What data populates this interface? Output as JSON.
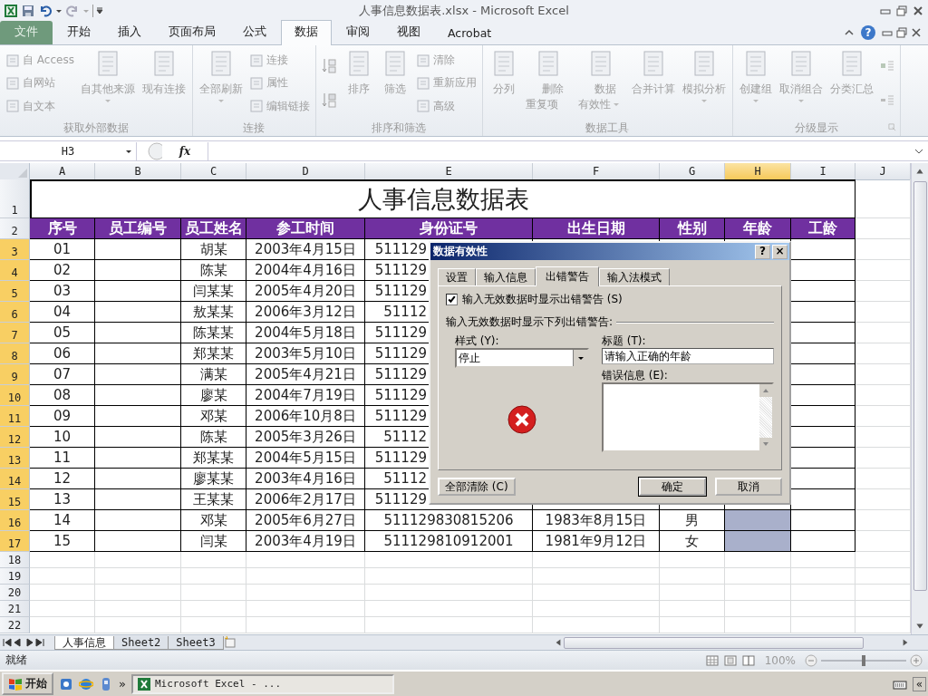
{
  "window": {
    "title": "人事信息数据表.xlsx - Microsoft Excel",
    "help_label": "?"
  },
  "ribbon_tabs": [
    {
      "label": "文件",
      "kind": "file",
      "selected": false
    },
    {
      "label": "开始",
      "kind": "tab",
      "selected": false
    },
    {
      "label": "插入",
      "kind": "tab",
      "selected": false
    },
    {
      "label": "页面布局",
      "kind": "tab",
      "selected": false
    },
    {
      "label": "公式",
      "kind": "tab",
      "selected": false
    },
    {
      "label": "数据",
      "kind": "tab",
      "selected": true
    },
    {
      "label": "审阅",
      "kind": "tab",
      "selected": false
    },
    {
      "label": "视图",
      "kind": "tab",
      "selected": false
    },
    {
      "label": "Acrobat",
      "kind": "tab",
      "selected": false
    }
  ],
  "ribbon_groups": [
    {
      "title": "获取外部数据",
      "launcher": false,
      "items": [
        {
          "kind": "stack",
          "children": [
            {
              "label": "自 Access"
            },
            {
              "label": "自网站"
            },
            {
              "label": "自文本"
            }
          ]
        },
        {
          "kind": "large",
          "label": "自其他来源",
          "dropdown": true
        },
        {
          "kind": "large",
          "label": "现有连接",
          "dropdown": false
        }
      ]
    },
    {
      "title": "连接",
      "launcher": false,
      "items": [
        {
          "kind": "large",
          "label": "全部刷新",
          "dropdown": true
        },
        {
          "kind": "stack",
          "children": [
            {
              "label": "连接"
            },
            {
              "label": "属性"
            },
            {
              "label": "编辑链接"
            }
          ]
        }
      ]
    },
    {
      "title": "排序和筛选",
      "launcher": false,
      "items": [
        {
          "kind": "sort"
        },
        {
          "kind": "large",
          "label": "排序",
          "dropdown": false
        },
        {
          "kind": "large",
          "label": "筛选",
          "dropdown": false
        },
        {
          "kind": "stack",
          "children": [
            {
              "label": "清除"
            },
            {
              "label": "重新应用"
            },
            {
              "label": "高级"
            }
          ]
        }
      ]
    },
    {
      "title": "数据工具",
      "launcher": false,
      "items": [
        {
          "kind": "large",
          "label": "分列",
          "dropdown": false
        },
        {
          "kind": "tall",
          "label": "删除重复项",
          "dropdown": false
        },
        {
          "kind": "tall",
          "label": "数据有效性",
          "dropdown": true
        },
        {
          "kind": "large",
          "label": "合并计算",
          "dropdown": false
        },
        {
          "kind": "large",
          "label": "模拟分析",
          "dropdown": true
        }
      ]
    },
    {
      "title": "分级显示",
      "launcher": true,
      "items": [
        {
          "kind": "large",
          "label": "创建组",
          "dropdown": true
        },
        {
          "kind": "large",
          "label": "取消组合",
          "dropdown": true
        },
        {
          "kind": "large",
          "label": "分类汇总",
          "dropdown": false
        },
        {
          "kind": "icons"
        }
      ]
    }
  ],
  "formula_bar": {
    "name_box": "H3",
    "function_label": "fx"
  },
  "sheet": {
    "columns": [
      {
        "label": "A",
        "selected": false
      },
      {
        "label": "B",
        "selected": false
      },
      {
        "label": "C",
        "selected": false
      },
      {
        "label": "D",
        "selected": false
      },
      {
        "label": "E",
        "selected": false
      },
      {
        "label": "F",
        "selected": false
      },
      {
        "label": "G",
        "selected": false
      },
      {
        "label": "H",
        "selected": true
      },
      {
        "label": "I",
        "selected": false
      },
      {
        "label": "J",
        "selected": false
      }
    ],
    "rows": [
      {
        "kind": "title",
        "number": "1",
        "selected": false,
        "title": "人事信息数据表"
      },
      {
        "kind": "header",
        "number": "2",
        "selected": false,
        "headers": [
          "序号",
          "员工编号",
          "员工姓名",
          "参工时间",
          "身份证号",
          "出生日期",
          "性别",
          "年龄",
          "工龄"
        ]
      },
      {
        "kind": "data",
        "number": "3",
        "selected": true,
        "cells": [
          "01",
          null,
          "胡某",
          "2003年4月15日",
          "511129"
        ]
      },
      {
        "kind": "data",
        "number": "4",
        "selected": true,
        "cells": [
          "02",
          null,
          "陈某",
          "2004年4月16日",
          "511129"
        ]
      },
      {
        "kind": "data",
        "number": "5",
        "selected": true,
        "cells": [
          "03",
          null,
          "闫某某",
          "2005年4月20日",
          "511129"
        ]
      },
      {
        "kind": "data",
        "number": "6",
        "selected": true,
        "cells": [
          "04",
          null,
          "敖某某",
          "2006年3月12日",
          "51112"
        ]
      },
      {
        "kind": "data",
        "number": "7",
        "selected": true,
        "cells": [
          "05",
          null,
          "陈某某",
          "2004年5月18日",
          "511129"
        ]
      },
      {
        "kind": "data",
        "number": "8",
        "selected": true,
        "cells": [
          "06",
          null,
          "郑某某",
          "2003年5月10日",
          "511129"
        ]
      },
      {
        "kind": "data",
        "number": "9",
        "selected": true,
        "cells": [
          "07",
          null,
          "满某",
          "2005年4月21日",
          "511129"
        ]
      },
      {
        "kind": "data",
        "number": "10",
        "selected": true,
        "cells": [
          "08",
          null,
          "廖某",
          "2004年7月19日",
          "511129"
        ]
      },
      {
        "kind": "data",
        "number": "11",
        "selected": true,
        "cells": [
          "09",
          null,
          "邓某",
          "2006年10月8日",
          "511129"
        ]
      },
      {
        "kind": "data",
        "number": "12",
        "selected": true,
        "cells": [
          "10",
          null,
          "陈某",
          "2005年3月26日",
          "51112"
        ]
      },
      {
        "kind": "data",
        "number": "13",
        "selected": true,
        "cells": [
          "11",
          null,
          "郑某某",
          "2004年5月15日",
          "511129"
        ]
      },
      {
        "kind": "data",
        "number": "14",
        "selected": true,
        "cells": [
          "12",
          null,
          "廖某某",
          "2003年4月16日",
          "51112"
        ]
      },
      {
        "kind": "data",
        "number": "15",
        "selected": true,
        "cells": [
          "13",
          null,
          "王某某",
          "2006年2月17日",
          "511129"
        ]
      },
      {
        "kind": "data",
        "number": "16",
        "selected": true,
        "cells": [
          "14",
          null,
          "邓某",
          "2005年6月27日",
          "511129830815206",
          "1983年8月15日",
          "男"
        ]
      },
      {
        "kind": "data",
        "number": "17",
        "selected": true,
        "cells": [
          "15",
          null,
          "闫某",
          "2003年4月19日",
          "511129810912001",
          "1981年9月12日",
          "女"
        ]
      },
      {
        "kind": "blank",
        "number": "18",
        "selected": false
      },
      {
        "kind": "blank",
        "number": "19",
        "selected": false
      },
      {
        "kind": "blank",
        "number": "20",
        "selected": false
      },
      {
        "kind": "blank",
        "number": "21",
        "selected": false
      },
      {
        "kind": "blank",
        "number": "22",
        "selected": false
      }
    ]
  },
  "sheet_tabs": [
    {
      "label": "人事信息",
      "selected": true
    },
    {
      "label": "Sheet2",
      "selected": false
    },
    {
      "label": "Sheet3",
      "selected": false
    }
  ],
  "status_bar": {
    "text": "就绪",
    "zoom": "100%",
    "zoom_slider": {
      "level": 0.5
    }
  },
  "taskbar": {
    "start": "开始",
    "more": "»",
    "tasks": [
      {
        "label": "Microsoft Excel - ...",
        "selected": true
      }
    ],
    "tray_more": "«"
  },
  "dialog": {
    "title": "数据有效性",
    "help": "?",
    "close": "×",
    "tabs": [
      {
        "label": "设置",
        "selected": false
      },
      {
        "label": "输入信息",
        "selected": false
      },
      {
        "label": "出错警告",
        "selected": true
      },
      {
        "label": "输入法模式",
        "selected": false
      }
    ],
    "show_alert": {
      "label": "输入无效数据时显示出错警告 (S)",
      "checked": true
    },
    "section": "输入无效数据时显示下列出错警告:",
    "style_label": "样式 (Y):",
    "style_value": "停止",
    "title_label": "标题 (T):",
    "title_value": "请输入正确的年龄",
    "message_label": "错误信息 (E):",
    "buttons": [
      {
        "label": "全部清除 (C)",
        "kind": "clear"
      },
      {
        "label": "确定",
        "kind": "default"
      },
      {
        "label": "取消",
        "kind": "normal"
      }
    ]
  }
}
